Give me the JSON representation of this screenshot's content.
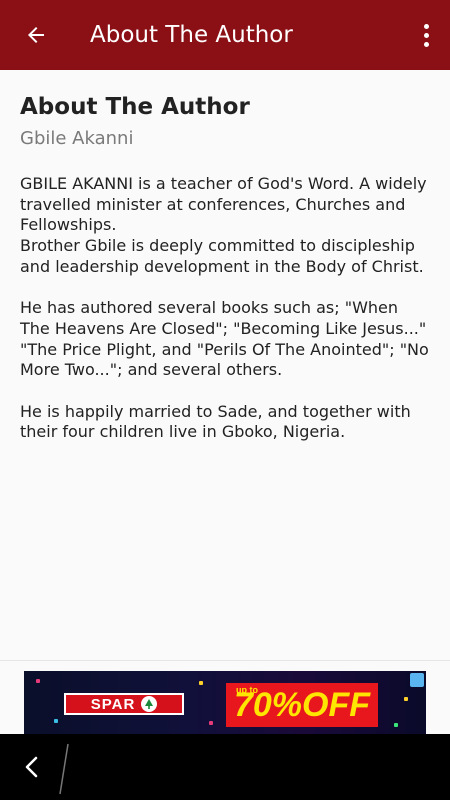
{
  "app_bar": {
    "title": "About The Author",
    "back_icon": "arrow-left-icon",
    "menu_icon": "more-vert-icon",
    "color": "#8b1016"
  },
  "content": {
    "heading": "About The Author",
    "subheading": "Gbile Akanni",
    "paragraphs": [
      "GBILE AKANNI is a teacher of God's Word. A widely travelled minister at conferences, Churches and Fellowships.",
      "Brother Gbile is deeply committed to discipleship and leadership development in the Body of Christ.",
      "He has authored several books such as; \"When The Heavens Are Closed\"; \"Becoming Like Jesus...\" \"The Price Plight, and \"Perils Of The Anointed\"; \"No More Two...\"; and several others.",
      "He is happily married to Sade, and together with their four children live in Gboko, Nigeria."
    ]
  },
  "ad": {
    "brand": "SPAR",
    "offer_prefix": "up to",
    "offer_text": "70%OFF"
  },
  "nav_bar": {
    "back_icon": "chevron-left-icon"
  }
}
